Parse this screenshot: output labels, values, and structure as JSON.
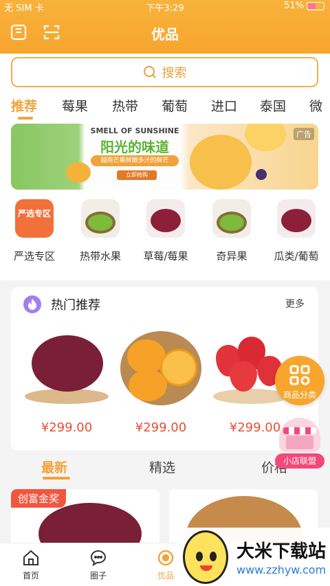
{
  "status": {
    "carrier": "无 SIM 卡",
    "time": "下午3:29",
    "battery": "51%"
  },
  "header": {
    "title": "优品"
  },
  "search": {
    "placeholder": "搜索"
  },
  "categories": [
    "推荐",
    "莓果",
    "热带",
    "葡萄",
    "进口",
    "泰国",
    "微"
  ],
  "banner": {
    "top_text": "SMELL OF SUNSHINE",
    "headline": "阳光的味道",
    "subline": "越南芒果鲜嫩多汁的鲜芒",
    "button": "立即抢购",
    "ad_label": "广告"
  },
  "quick": [
    {
      "label": "严选专区",
      "badge": "严选专区"
    },
    {
      "label": "热带水果"
    },
    {
      "label": "草莓/莓果"
    },
    {
      "label": "奇异果"
    },
    {
      "label": "瓜类/葡萄"
    }
  ],
  "hot": {
    "title": "热门推荐",
    "more": "更多",
    "products": [
      {
        "price": "¥299.00"
      },
      {
        "price": "¥299.00"
      },
      {
        "price": "¥299.00"
      }
    ]
  },
  "tabs2": [
    "最新",
    "精选",
    "价格"
  ],
  "feed": {
    "award": "创富金奖"
  },
  "floating": {
    "categories": "商品分类",
    "alliance": "小店联盟"
  },
  "tabbar": [
    "首页",
    "圈子",
    "优品"
  ],
  "watermark": {
    "title": "大米下载站",
    "url": "www.zzhyw.com"
  },
  "colors": {
    "accent": "#f3a23a",
    "price": "#e84f32",
    "header": "#f7a52d"
  }
}
